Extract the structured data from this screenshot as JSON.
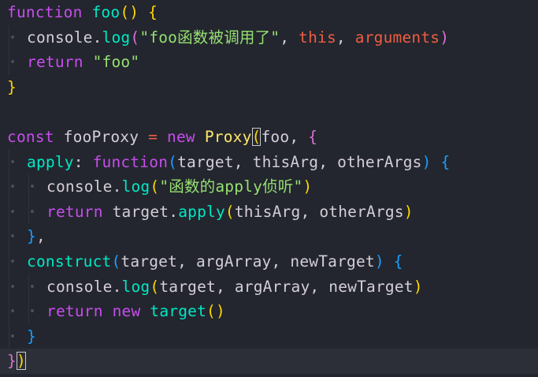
{
  "editor": {
    "lines": [
      {
        "tokens": [
          {
            "t": "function",
            "c": "kw"
          },
          {
            "t": " ",
            "c": "var"
          },
          {
            "t": "foo",
            "c": "fn"
          },
          {
            "t": "()",
            "c": "br1"
          },
          {
            "t": " ",
            "c": "var"
          },
          {
            "t": "{",
            "c": "br1"
          }
        ],
        "indent": 0
      },
      {
        "tokens": [
          {
            "t": "console",
            "c": "var"
          },
          {
            "t": ".",
            "c": "var"
          },
          {
            "t": "log",
            "c": "fn"
          },
          {
            "t": "(",
            "c": "br2"
          },
          {
            "t": "\"foo函数被调用了\"",
            "c": "str"
          },
          {
            "t": ", ",
            "c": "var"
          },
          {
            "t": "this",
            "c": "th"
          },
          {
            "t": ", ",
            "c": "var"
          },
          {
            "t": "arguments",
            "c": "th"
          },
          {
            "t": ")",
            "c": "br2"
          }
        ],
        "indent": 1
      },
      {
        "tokens": [
          {
            "t": "return",
            "c": "kw"
          },
          {
            "t": " ",
            "c": "var"
          },
          {
            "t": "\"foo\"",
            "c": "str"
          }
        ],
        "indent": 1
      },
      {
        "tokens": [
          {
            "t": "}",
            "c": "br1"
          }
        ],
        "indent": 0
      },
      {
        "tokens": [],
        "indent": 0
      },
      {
        "tokens": [
          {
            "t": "const",
            "c": "kw"
          },
          {
            "t": " ",
            "c": "var"
          },
          {
            "t": "fooProxy",
            "c": "var"
          },
          {
            "t": " ",
            "c": "var"
          },
          {
            "t": "=",
            "c": "op"
          },
          {
            "t": " ",
            "c": "var"
          },
          {
            "t": "new",
            "c": "kw"
          },
          {
            "t": " ",
            "c": "var"
          },
          {
            "t": "Proxy",
            "c": "cls"
          },
          {
            "t": "(",
            "c": "br1",
            "m": true
          },
          {
            "t": "foo",
            "c": "var"
          },
          {
            "t": ", ",
            "c": "var"
          },
          {
            "t": "{",
            "c": "br2"
          }
        ],
        "indent": 0
      },
      {
        "tokens": [
          {
            "t": "apply",
            "c": "fn"
          },
          {
            "t": ":",
            "c": "var"
          },
          {
            "t": " ",
            "c": "var"
          },
          {
            "t": "function",
            "c": "kw"
          },
          {
            "t": "(",
            "c": "br3"
          },
          {
            "t": "target",
            "c": "var"
          },
          {
            "t": ", ",
            "c": "var"
          },
          {
            "t": "thisArg",
            "c": "var"
          },
          {
            "t": ", ",
            "c": "var"
          },
          {
            "t": "otherArgs",
            "c": "var"
          },
          {
            "t": ")",
            "c": "br3"
          },
          {
            "t": " ",
            "c": "var"
          },
          {
            "t": "{",
            "c": "br3"
          }
        ],
        "indent": 1
      },
      {
        "tokens": [
          {
            "t": "console",
            "c": "var"
          },
          {
            "t": ".",
            "c": "var"
          },
          {
            "t": "log",
            "c": "fn"
          },
          {
            "t": "(",
            "c": "br1"
          },
          {
            "t": "\"函数的apply侦听\"",
            "c": "str"
          },
          {
            "t": ")",
            "c": "br1"
          }
        ],
        "indent": 2
      },
      {
        "tokens": [
          {
            "t": "return",
            "c": "kw"
          },
          {
            "t": " ",
            "c": "var"
          },
          {
            "t": "target",
            "c": "var"
          },
          {
            "t": ".",
            "c": "var"
          },
          {
            "t": "apply",
            "c": "fn"
          },
          {
            "t": "(",
            "c": "br1"
          },
          {
            "t": "thisArg",
            "c": "var"
          },
          {
            "t": ", ",
            "c": "var"
          },
          {
            "t": "otherArgs",
            "c": "var"
          },
          {
            "t": ")",
            "c": "br1"
          }
        ],
        "indent": 2
      },
      {
        "tokens": [
          {
            "t": "}",
            "c": "br3"
          },
          {
            "t": ",",
            "c": "var"
          }
        ],
        "indent": 1
      },
      {
        "tokens": [
          {
            "t": "construct",
            "c": "fn"
          },
          {
            "t": "(",
            "c": "br3"
          },
          {
            "t": "target",
            "c": "var"
          },
          {
            "t": ", ",
            "c": "var"
          },
          {
            "t": "argArray",
            "c": "var"
          },
          {
            "t": ", ",
            "c": "var"
          },
          {
            "t": "newTarget",
            "c": "var"
          },
          {
            "t": ")",
            "c": "br3"
          },
          {
            "t": " ",
            "c": "var"
          },
          {
            "t": "{",
            "c": "br3"
          }
        ],
        "indent": 1
      },
      {
        "tokens": [
          {
            "t": "console",
            "c": "var"
          },
          {
            "t": ".",
            "c": "var"
          },
          {
            "t": "log",
            "c": "fn"
          },
          {
            "t": "(",
            "c": "br1"
          },
          {
            "t": "target",
            "c": "var"
          },
          {
            "t": ", ",
            "c": "var"
          },
          {
            "t": "argArray",
            "c": "var"
          },
          {
            "t": ", ",
            "c": "var"
          },
          {
            "t": "newTarget",
            "c": "var"
          },
          {
            "t": ")",
            "c": "br1"
          }
        ],
        "indent": 2
      },
      {
        "tokens": [
          {
            "t": "return",
            "c": "kw"
          },
          {
            "t": " ",
            "c": "var"
          },
          {
            "t": "new",
            "c": "kw"
          },
          {
            "t": " ",
            "c": "var"
          },
          {
            "t": "target",
            "c": "fn"
          },
          {
            "t": "()",
            "c": "br1"
          }
        ],
        "indent": 2
      },
      {
        "tokens": [
          {
            "t": "}",
            "c": "br3"
          }
        ],
        "indent": 1
      },
      {
        "tokens": [
          {
            "t": "}",
            "c": "br2"
          },
          {
            "t": ")",
            "c": "br1",
            "m": true
          }
        ],
        "indent": 0,
        "current": true
      }
    ]
  }
}
